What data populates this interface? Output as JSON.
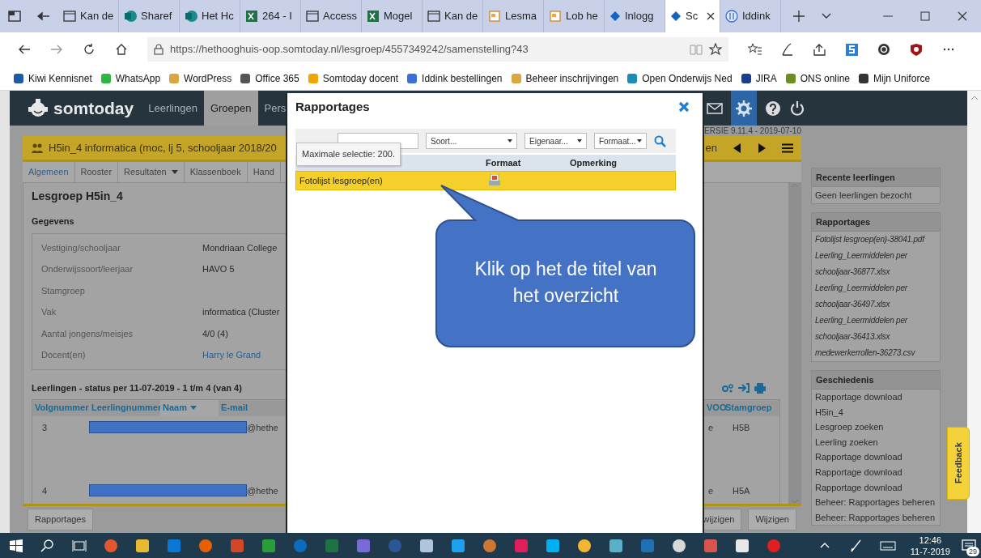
{
  "browser": {
    "tabs": [
      {
        "label": "Kan de",
        "selected": false
      },
      {
        "label": "Sharef",
        "selected": false
      },
      {
        "label": "Het Hc",
        "selected": false
      },
      {
        "label": "264 - I",
        "selected": false
      },
      {
        "label": "Access",
        "selected": false
      },
      {
        "label": "Mogel",
        "selected": false
      },
      {
        "label": "Kan de",
        "selected": false
      },
      {
        "label": "Lesma",
        "selected": false
      },
      {
        "label": "Lob he",
        "selected": false
      },
      {
        "label": "Inlogg",
        "selected": false
      },
      {
        "label": "Sc",
        "selected": true
      },
      {
        "label": "Iddink",
        "selected": false
      }
    ],
    "url": "https://hethooghuis-oop.somtoday.nl/lesgroep/4557349242/samenstelling?43",
    "bookmarks": [
      "Kiwi Kennisnet",
      "WhatsApp",
      "WordPress",
      "Office 365",
      "Somtoday docent",
      "Iddink bestellingen",
      "Beheer inschrijvingen",
      "Open Onderwijs Ned",
      "JIRA",
      "ONS online",
      "Mijn Uniforce"
    ]
  },
  "app": {
    "brand": "somtoday",
    "nav": [
      {
        "label": "Leerlingen",
        "selected": false
      },
      {
        "label": "Groepen",
        "selected": true
      },
      {
        "label": "Pers",
        "selected": false
      }
    ],
    "version": "ERSIE 9.11.4 - 2019-07-10",
    "group_title": "H5in_4 informatica (moc, lj 5, schooljaar 2018/20",
    "group_nav_label": "en",
    "subtabs": [
      {
        "label": "Algemeen",
        "selected": true,
        "dropdown": false
      },
      {
        "label": "Rooster",
        "selected": false,
        "dropdown": false
      },
      {
        "label": "Resultaten",
        "selected": false,
        "dropdown": true
      },
      {
        "label": "Klassenboek",
        "selected": false,
        "dropdown": false
      },
      {
        "label": "Hand",
        "selected": false,
        "dropdown": false
      }
    ],
    "heading": "Lesgroep H5in_4",
    "section": "Gegevens",
    "details": [
      {
        "label": "Vestiging/schooljaar",
        "value": "Mondriaan College",
        "kind": "text"
      },
      {
        "label": "Onderwijssoort/leerjaar",
        "value": "HAVO 5",
        "kind": "text"
      },
      {
        "label": "Stamgroep",
        "kind": "text"
      },
      {
        "label": "Vak",
        "value": "informatica (Cluster",
        "kind": "text"
      },
      {
        "label": "Aantal jongens/meisjes",
        "value": "4/0 (4)",
        "kind": "text"
      },
      {
        "label": "Docent(en)",
        "value": "Harry le Grand",
        "kind": "link"
      }
    ],
    "students": {
      "title": "Leerlingen - status per 11-07-2019 - 1 t/m 4 (van 4)",
      "columns": [
        {
          "label": "Volgnummer",
          "sorted": false
        },
        {
          "label": "Leerlingnummer",
          "sorted": false
        },
        {
          "label": "Naam",
          "sorted": true
        },
        {
          "label": "E-mail",
          "sorted": false
        }
      ],
      "columns_right": [
        "VOO",
        "Stamgroep"
      ],
      "rows": [
        {
          "volgnummer": "3",
          "email": "@hethe",
          "column_5": "e",
          "stamgroep": "H5B"
        },
        {
          "volgnummer": "4",
          "email": "@hethe",
          "column_5": "e",
          "stamgroep": "H5A"
        }
      ]
    },
    "buttons_left": [
      "Rapportages"
    ],
    "buttons_right": [
      "wijzigen",
      "Wijzigen"
    ]
  },
  "sidebar": {
    "panels": [
      {
        "title": "Recente leerlingen",
        "italic": false,
        "items": [
          "Geen leerlingen bezocht"
        ]
      },
      {
        "title": "Rapportages",
        "italic": true,
        "items": [
          "Fotolijst lesgroep(en)-38041.pdf",
          "Leerling_Leermiddelen per schooljaar-36877.xlsx",
          "Leerling_Leermiddelen per schooljaar-36497.xlsx",
          "Leerling_Leermiddelen per schooljaar-36413.xlsx",
          "medewerkerrollen-36273.csv"
        ]
      },
      {
        "title": "Geschiedenis",
        "italic": false,
        "items": [
          "Rapportage download",
          "H5in_4",
          "Lesgroep zoeken",
          "Leerling zoeken",
          "Rapportage download",
          "Rapportage download",
          "Rapportage download",
          "Beheer: Rapportages beheren",
          "Beheer: Rapportages beheren"
        ]
      }
    ]
  },
  "feedback": "Feedback",
  "modal": {
    "title": "Rapportages",
    "selects": [
      "Soort...",
      "Eigenaar...",
      "Formaat..."
    ],
    "tooltip": "Maximale selectie: 200.",
    "columns": [
      "Formaat",
      "Opmerking"
    ],
    "rows": [
      {
        "naam": "Fotolijst lesgroep(en)",
        "selected": true
      }
    ]
  },
  "callout": "Klik op het de titel van het overzicht",
  "taskbar": {
    "time": "12:46",
    "date": "11-7-2019",
    "notifications": "29"
  }
}
